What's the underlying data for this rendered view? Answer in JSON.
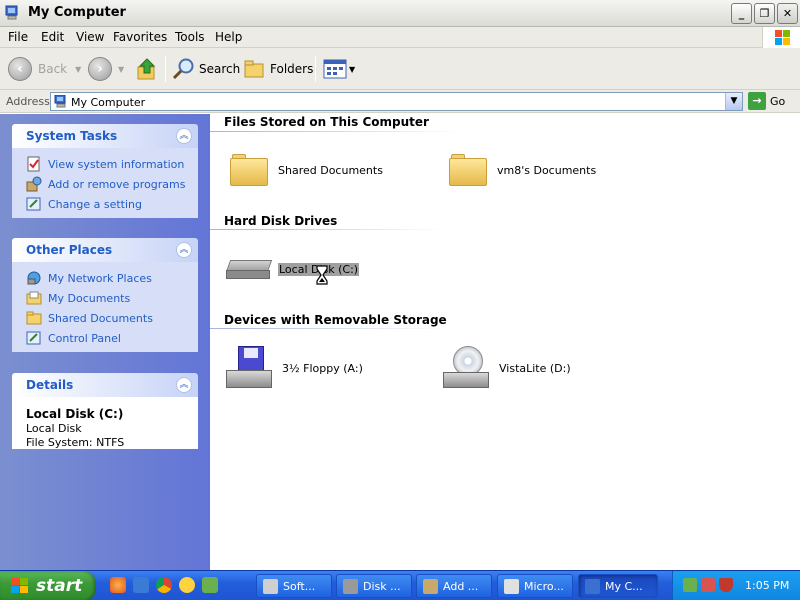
{
  "window": {
    "title": "My Computer",
    "buttons": {
      "minimize": "_",
      "maximize": "❐",
      "close": "✕"
    }
  },
  "menu": [
    "File",
    "Edit",
    "View",
    "Favorites",
    "Tools",
    "Help"
  ],
  "toolbar": {
    "back": "Back",
    "search": "Search",
    "folders": "Folders"
  },
  "address": {
    "label": "Address",
    "value": "My Computer",
    "go": "Go"
  },
  "taskpane": {
    "system_tasks": {
      "title": "System Tasks",
      "items": [
        "View system information",
        "Add or remove programs",
        "Change a setting"
      ]
    },
    "other_places": {
      "title": "Other Places",
      "items": [
        "My Network Places",
        "My Documents",
        "Shared Documents",
        "Control Panel"
      ]
    },
    "details": {
      "title": "Details",
      "name": "Local Disk (C:)",
      "type": "Local Disk",
      "filesystem": "File System: NTFS"
    }
  },
  "main": {
    "files_section": "Files Stored on This Computer",
    "shared_documents": "Shared Documents",
    "user_documents": "vm8's Documents",
    "hdd_section": "Hard Disk Drives",
    "local_disk": "Local Disk (C:)",
    "removable_section": "Devices with Removable Storage",
    "floppy": "3½ Floppy (A:)",
    "cd": "VistaLite (D:)"
  },
  "taskbar": {
    "start": "start",
    "tasks": [
      "Soft...",
      "Disk ...",
      "Add ...",
      "Micro...",
      "My C..."
    ],
    "clock": "1:05 PM"
  },
  "colors": {
    "link_blue": "#215dc6",
    "taskpane_bg": "#6375d6",
    "taskbar_blue": "#245edb",
    "start_green": "#3c9b38"
  }
}
